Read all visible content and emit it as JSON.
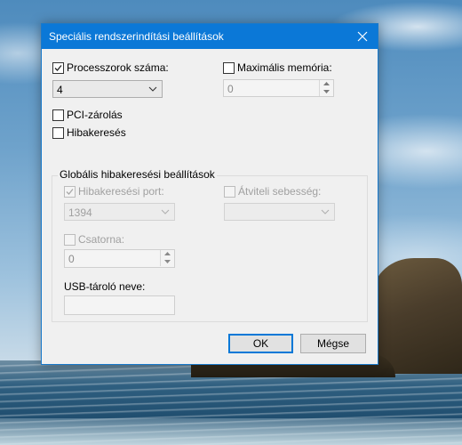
{
  "dialog": {
    "title": "Speciális rendszerindítási beállítások"
  },
  "processor_count": {
    "label": "Processzorok száma:",
    "checked": true,
    "value": "4"
  },
  "max_memory": {
    "label": "Maximális memória:",
    "checked": false,
    "value": "0"
  },
  "pci_lock": {
    "label": "PCI-zárolás",
    "checked": false
  },
  "debugging": {
    "label": "Hibakeresés",
    "checked": false
  },
  "global_debug": {
    "group_label": "Globális hibakeresési beállítások",
    "debug_port": {
      "label": "Hibakeresési port:",
      "checked": true,
      "value": "1394"
    },
    "baud_rate": {
      "label": "Átviteli sebesség:",
      "checked": false,
      "value": ""
    },
    "channel": {
      "label": "Csatorna:",
      "checked": false,
      "value": "0"
    },
    "usb_target": {
      "label": "USB-tároló neve:",
      "value": ""
    }
  },
  "buttons": {
    "ok": "OK",
    "cancel": "Mégse"
  },
  "icons": {
    "close": "close-icon",
    "check": "checkmark-icon",
    "dropdown": "chevron-down-icon",
    "spin_up": "caret-up-icon",
    "spin_down": "caret-down-icon"
  },
  "colors": {
    "titlebar": "#0b78d7",
    "default_button_border": "#0078d7",
    "dialog_bg": "#f0f0f0"
  }
}
